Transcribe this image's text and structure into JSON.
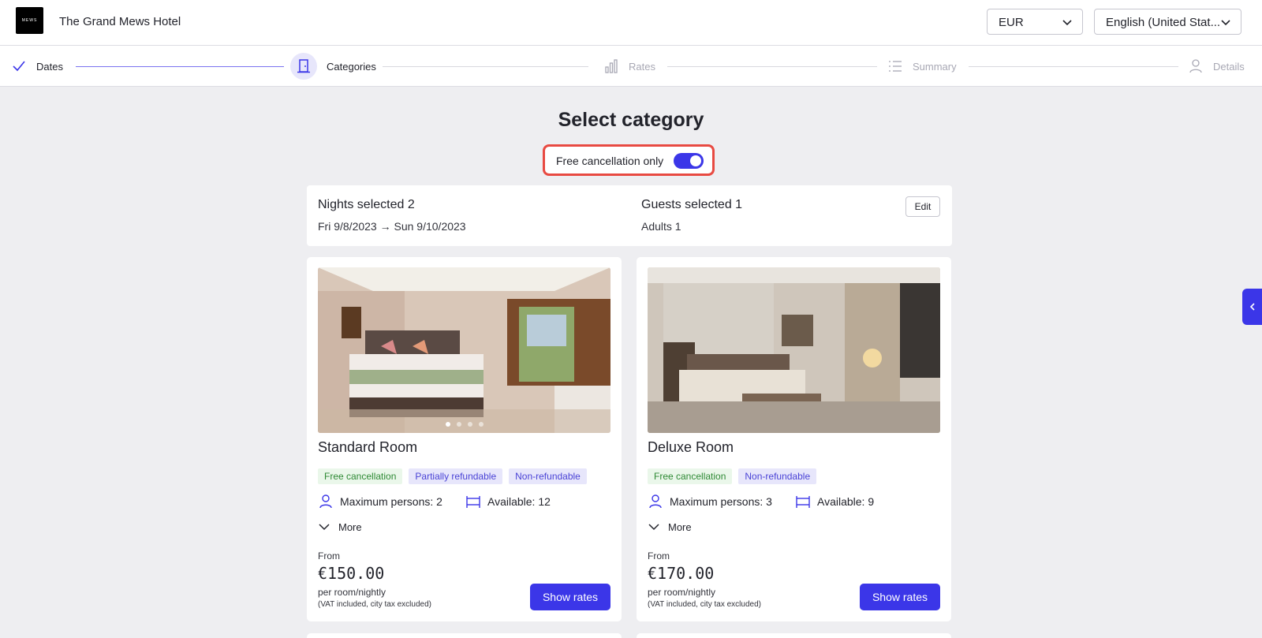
{
  "header": {
    "hotel_name": "The Grand Mews Hotel",
    "logo_text": "MEWS",
    "currency": "EUR",
    "language": "English (United Stat..."
  },
  "stepper": [
    {
      "label": "Dates",
      "state": "done",
      "icon": "check-icon"
    },
    {
      "label": "Categories",
      "state": "active",
      "icon": "door-icon"
    },
    {
      "label": "Rates",
      "state": "todo",
      "icon": "bar-chart-icon"
    },
    {
      "label": "Summary",
      "state": "todo",
      "icon": "list-icon"
    },
    {
      "label": "Details",
      "state": "todo",
      "icon": "person-icon"
    }
  ],
  "main": {
    "title": "Select category",
    "filter_label": "Free cancellation only",
    "filter_on": true
  },
  "summary": {
    "nights_label": "Nights selected 2",
    "dates_from": "Fri 9/8/2023",
    "dates_arrow": "→",
    "dates_to": "Sun 9/10/2023",
    "guests_label": "Guests selected 1",
    "guests_detail": "Adults 1",
    "edit_label": "Edit"
  },
  "rooms": [
    {
      "name": "Standard Room",
      "tags": [
        "Free cancellation",
        "Partially refundable",
        "Non-refundable"
      ],
      "max_persons": "Maximum persons: 2",
      "available": "Available: 12",
      "more": "More",
      "from": "From",
      "price": "€150.00",
      "per": "per room/nightly",
      "vat": "(VAT included, city tax excluded)",
      "button": "Show rates",
      "photo_count": 4,
      "photo_index": 1
    },
    {
      "name": "Deluxe Room",
      "tags": [
        "Free cancellation",
        "Non-refundable"
      ],
      "max_persons": "Maximum persons: 3",
      "available": "Available: 9",
      "more": "More",
      "from": "From",
      "price": "€170.00",
      "per": "per room/nightly",
      "vat": "(VAT included, city tax excluded)",
      "button": "Show rates"
    }
  ],
  "colors": {
    "accent": "#3b36e8",
    "highlight_border": "#e84a42",
    "tag_green_text": "#2f8a35",
    "tag_purple_text": "#4a43d6"
  }
}
